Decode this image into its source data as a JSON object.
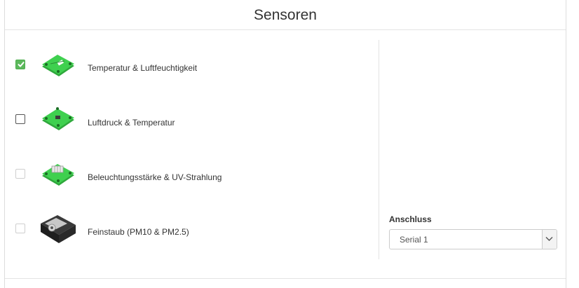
{
  "header": {
    "title": "Sensoren"
  },
  "sensors": [
    {
      "label": "Temperatur & Luftfeuchtigkeit",
      "checked": true,
      "icon": "sensor-board-green-icon"
    },
    {
      "label": "Luftdruck & Temperatur",
      "checked": false,
      "icon": "sensor-board-green-icon"
    },
    {
      "label": "Beleuchtungsstärke & UV-Strahlung",
      "checked": false,
      "icon": "sensor-board-green-icon"
    },
    {
      "label": "Feinstaub (PM10 & PM2.5)",
      "checked": false,
      "icon": "particulate-sensor-icon"
    }
  ],
  "connection": {
    "label": "Anschluss",
    "selected": "Serial 1"
  },
  "colors": {
    "checked": "#5cb85c",
    "pcb_green": "#39c24a",
    "border": "#dddddd"
  }
}
